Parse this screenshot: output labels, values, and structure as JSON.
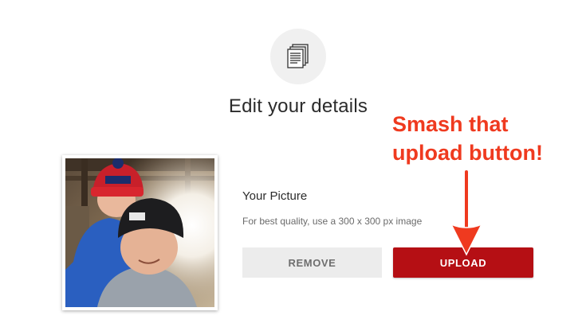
{
  "header": {
    "title": "Edit your details",
    "icon": "documents-icon"
  },
  "profile_picture": {
    "label": "Your Picture",
    "hint": "For best quality, use a 300 x 300 px image",
    "remove_label": "REMOVE",
    "upload_label": "UPLOAD"
  },
  "annotation": {
    "line1": "Smash that",
    "line2": "upload button!",
    "color": "#ef3a1f"
  },
  "colors": {
    "upload_button": "#b50f14",
    "remove_button": "#ececec"
  }
}
